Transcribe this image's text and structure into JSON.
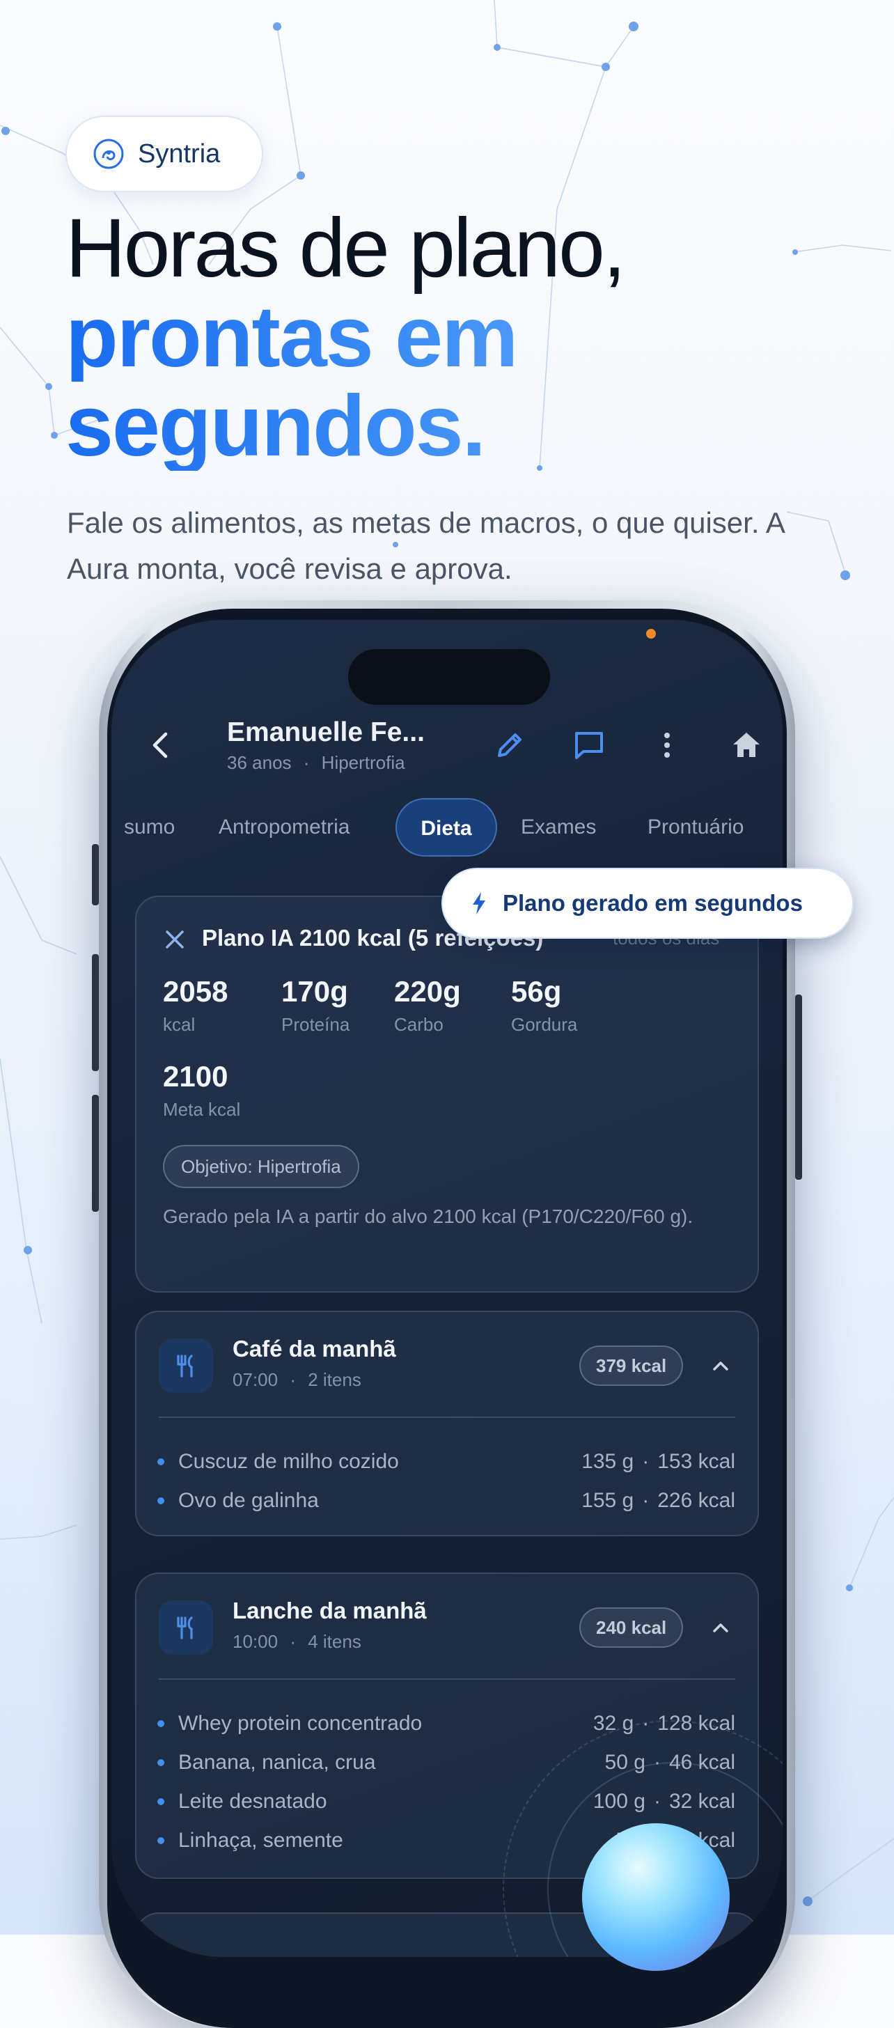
{
  "brand": {
    "name": "Syntria"
  },
  "headline": {
    "line1": "Horas de plano,",
    "line2": "prontas em",
    "line3": "segundos."
  },
  "subtitle": "Fale os alimentos, as metas de macros, o que quiser. A Aura monta, você revisa e aprova.",
  "patient": {
    "name": "Emanuelle Fe...",
    "age": "36 anos",
    "separator": "·",
    "goal": "Hipertrofia"
  },
  "tabs": [
    {
      "label": "sumo",
      "active": false
    },
    {
      "label": "Antropometria",
      "active": false
    },
    {
      "label": "Dieta",
      "active": true
    },
    {
      "label": "Exames",
      "active": false
    },
    {
      "label": "Prontuário",
      "active": false
    }
  ],
  "toast": {
    "label": "Plano gerado em segundos"
  },
  "plan": {
    "title": "Plano IA 2100 kcal (5 refeições)",
    "frequency": "todos os dias",
    "stats": [
      {
        "value": "2058",
        "label": "kcal"
      },
      {
        "value": "170g",
        "label": "Proteína"
      },
      {
        "value": "220g",
        "label": "Carbo"
      },
      {
        "value": "56g",
        "label": "Gordura"
      }
    ],
    "target": {
      "value": "2100",
      "label": "Meta kcal"
    },
    "objective_chip": "Objetivo: Hipertrofia",
    "note": "Gerado pela IA a partir do alvo 2100 kcal (P170/C220/F60 g)."
  },
  "meals": [
    {
      "title": "Café da manhã",
      "time": "07:00",
      "count": "2 itens",
      "kcal": "379 kcal",
      "items": [
        {
          "name": "Cuscuz de milho cozido",
          "qty": "135 g",
          "kcal": "153 kcal"
        },
        {
          "name": "Ovo de galinha",
          "qty": "155 g",
          "kcal": "226 kcal"
        }
      ]
    },
    {
      "title": "Lanche da manhã",
      "time": "10:00",
      "count": "4 itens",
      "kcal": "240 kcal",
      "items": [
        {
          "name": "Whey protein concentrado",
          "qty": "32 g",
          "kcal": "128 kcal"
        },
        {
          "name": "Banana, nanica, crua",
          "qty": "50 g",
          "kcal": "46 kcal"
        },
        {
          "name": "Leite desnatado",
          "qty": "100 g",
          "kcal": "32 kcal"
        },
        {
          "name": "Linhaça, semente",
          "qty": "7 g",
          "kcal": "35 kcal"
        }
      ]
    }
  ],
  "colors": {
    "accent": "#1a6cf0",
    "screen_bg": "#172338",
    "toast_text": "#163a78"
  }
}
